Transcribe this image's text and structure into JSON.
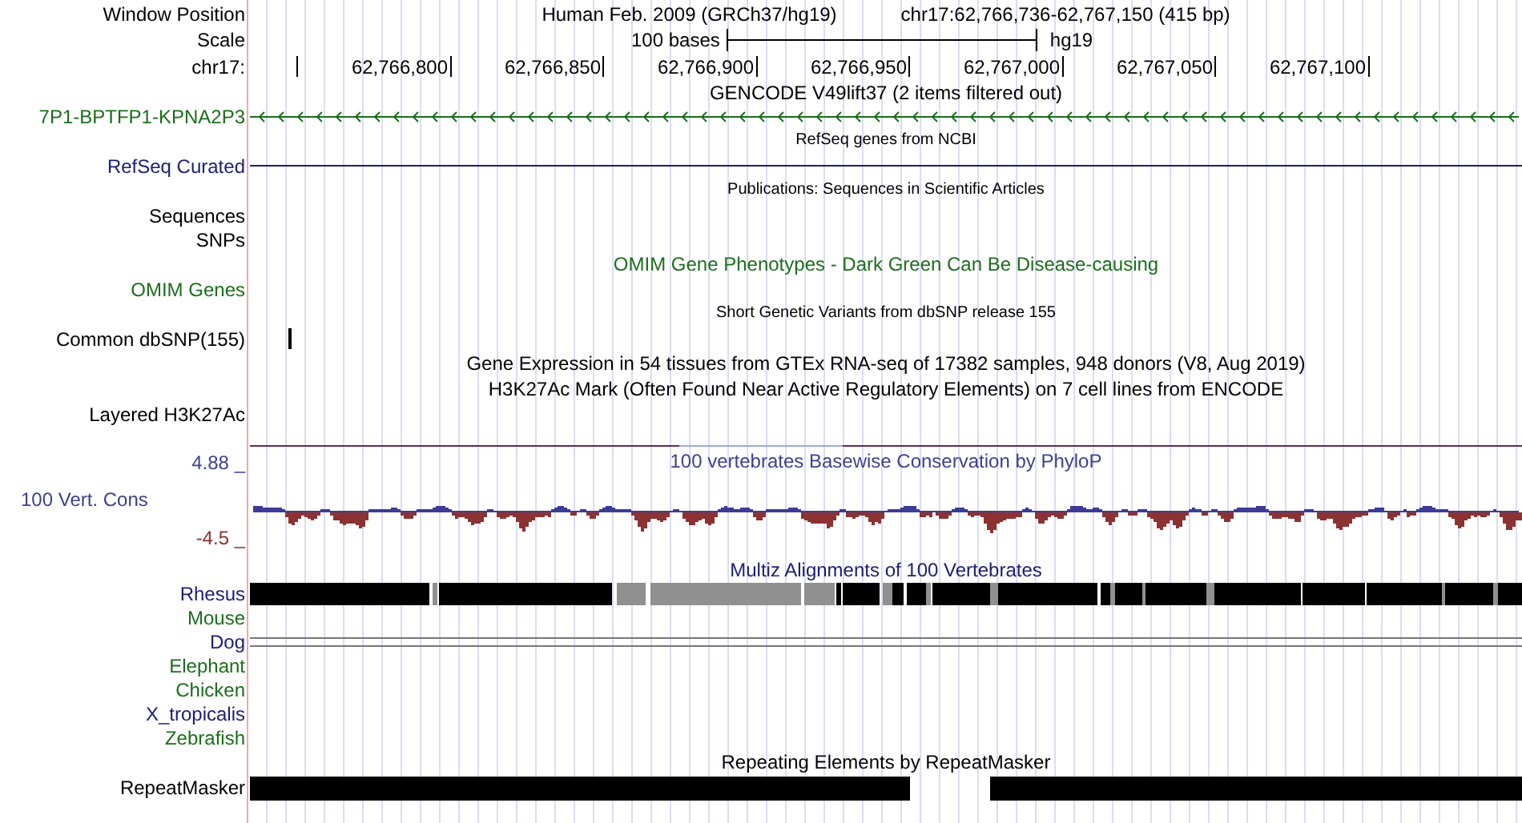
{
  "header": {
    "label": "Window Position",
    "assembly": "Human Feb. 2009 (GRCh37/hg19)",
    "position": "chr17:62,766,736-62,767,150 (415 bp)"
  },
  "scale": {
    "label": "Scale",
    "length": "100 bases",
    "assembly": "hg19"
  },
  "ruler": {
    "label": "chr17:",
    "ticks": [
      "62,766,800",
      "62,766,850",
      "62,766,900",
      "62,766,950",
      "62,767,000",
      "62,767,050",
      "62,767,100"
    ]
  },
  "rows": [
    {
      "kind": "title",
      "text": "GENCODE V49lift37 (2 items filtered out)"
    },
    {
      "kind": "gene",
      "label": "7P1-BPTFP1-KPNA2P3",
      "color": "#1b6e1b"
    },
    {
      "kind": "note",
      "text": "RefSeq genes from NCBI"
    },
    {
      "kind": "line",
      "label": "RefSeq Curated",
      "color": "#1c1c74"
    },
    {
      "kind": "note",
      "text": "Publications: Sequences in Scientific Articles"
    },
    {
      "kind": "label",
      "label": "Sequences"
    },
    {
      "kind": "label",
      "label": "SNPs"
    },
    {
      "kind": "title",
      "text": "OMIM Gene Phenotypes - Dark Green Can Be Disease-causing",
      "color": "#1b6e1b"
    },
    {
      "kind": "label",
      "label": "OMIM Genes",
      "color": "#1b6e1b"
    },
    {
      "kind": "note",
      "text": "Short Genetic Variants from dbSNP release 155"
    },
    {
      "kind": "snp",
      "label": "Common dbSNP(155)"
    },
    {
      "kind": "title",
      "text": "Gene Expression in 54 tissues from GTEx RNA-seq of 17382 samples, 948 donors (V8, Aug 2019)"
    },
    {
      "kind": "title",
      "text": "H3K27Ac Mark (Often Found Near Active Regulatory Elements) on 7 cell lines from ENCODE"
    },
    {
      "kind": "label",
      "label": "Layered H3K27Ac"
    },
    {
      "kind": "wiggle",
      "label": "100 Vert. Cons",
      "title": "100 vertebrates Basewise Conservation by PhyloP",
      "max": "4.88 _",
      "min": "-4.5 _",
      "color": "#3f3f8f"
    },
    {
      "kind": "title",
      "text": "Multiz Alignments of 100 Vertebrates",
      "color": "#1c1c74"
    },
    {
      "kind": "alignment",
      "label": "Rhesus",
      "color": "#1c1c74"
    },
    {
      "kind": "label",
      "label": "Mouse",
      "color": "#1b6e1b"
    },
    {
      "kind": "double_line",
      "label": "Dog",
      "color": "#1c1c74"
    },
    {
      "kind": "label",
      "label": "Elephant",
      "color": "#1b6e1b"
    },
    {
      "kind": "label",
      "label": "Chicken",
      "color": "#1b6e1b"
    },
    {
      "kind": "label",
      "label": "X_tropicalis",
      "color": "#1c1c74"
    },
    {
      "kind": "label",
      "label": "Zebrafish",
      "color": "#1b6e1b"
    },
    {
      "kind": "title",
      "text": "Repeating Elements by RepeatMasker"
    },
    {
      "kind": "repeat",
      "label": "RepeatMasker"
    }
  ]
}
